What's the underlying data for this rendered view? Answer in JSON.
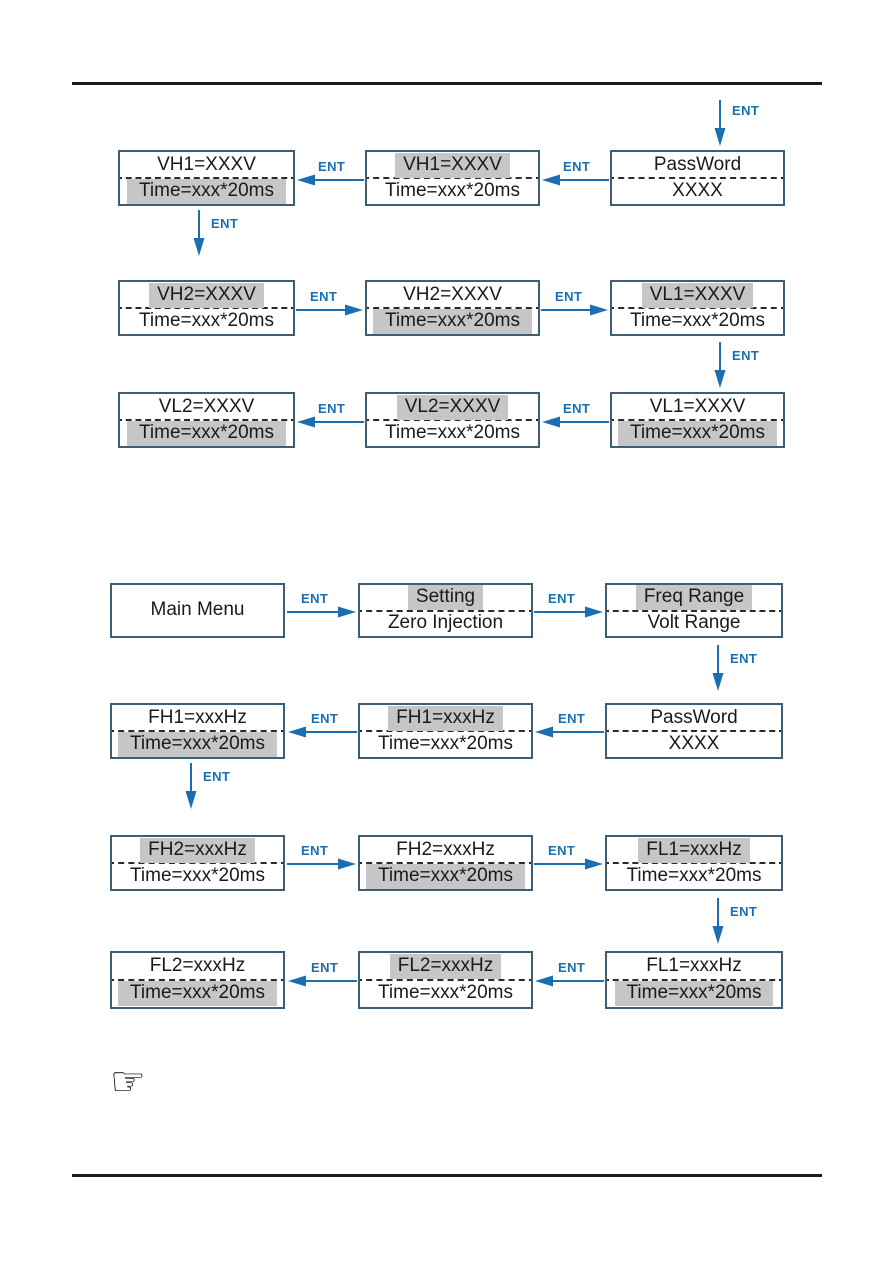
{
  "colors": {
    "lcd_border": "#3d5f76",
    "highlight": "#c6c6c6",
    "arrow_blue": "#1b6fb0",
    "rule_black": "#1c1c1c",
    "text_black": "#1a1a1a"
  },
  "labels": {
    "ent": "ENT"
  },
  "icons": {
    "hand": "☞"
  },
  "volt_section": {
    "screens": [
      {
        "id": "vh1-left",
        "top": "VH1=XXXV",
        "bottom": "Time=xxx*20ms",
        "selected": "bottom"
      },
      {
        "id": "vh1-mid",
        "top": "VH1=XXXV",
        "bottom": "Time=xxx*20ms",
        "selected": "top"
      },
      {
        "id": "password",
        "top": "PassWord",
        "bottom": "XXXX",
        "selected": "none"
      },
      {
        "id": "vh2-left",
        "top": "VH2=XXXV",
        "bottom": "Time=xxx*20ms",
        "selected": "top"
      },
      {
        "id": "vh2-mid",
        "top": "VH2=XXXV",
        "bottom": "Time=xxx*20ms",
        "selected": "bottom"
      },
      {
        "id": "vl1-right",
        "top": "VL1=XXXV",
        "bottom": "Time=xxx*20ms",
        "selected": "top"
      },
      {
        "id": "vl2-left",
        "top": "VL2=XXXV",
        "bottom": "Time=xxx*20ms",
        "selected": "bottom"
      },
      {
        "id": "vl2-mid",
        "top": "VL2=XXXV",
        "bottom": "Time=xxx*20ms",
        "selected": "top"
      },
      {
        "id": "vl1-bottom",
        "top": "VL1=XXXV",
        "bottom": "Time=xxx*20ms",
        "selected": "bottom"
      }
    ]
  },
  "freq_section": {
    "screens": [
      {
        "id": "main-menu",
        "top": "Main Menu",
        "bottom": "",
        "selected": "none"
      },
      {
        "id": "setting",
        "top": "Setting",
        "bottom": "Zero Injection",
        "selected": "top"
      },
      {
        "id": "freq-range",
        "top": "Freq Range",
        "bottom": "Volt Range",
        "selected": "top"
      },
      {
        "id": "fh1-left",
        "top": "FH1=xxxHz",
        "bottom": "Time=xxx*20ms",
        "selected": "bottom"
      },
      {
        "id": "fh1-mid",
        "top": "FH1=xxxHz",
        "bottom": "Time=xxx*20ms",
        "selected": "top"
      },
      {
        "id": "password2",
        "top": "PassWord",
        "bottom": "XXXX",
        "selected": "none"
      },
      {
        "id": "fh2-left",
        "top": "FH2=xxxHz",
        "bottom": "Time=xxx*20ms",
        "selected": "top"
      },
      {
        "id": "fh2-mid",
        "top": "FH2=xxxHz",
        "bottom": "Time=xxx*20ms",
        "selected": "bottom"
      },
      {
        "id": "fl1-right",
        "top": "FL1=xxxHz",
        "bottom": "Time=xxx*20ms",
        "selected": "top"
      },
      {
        "id": "fl2-left",
        "top": "FL2=xxxHz",
        "bottom": "Time=xxx*20ms",
        "selected": "bottom"
      },
      {
        "id": "fl2-mid",
        "top": "FL2=xxxHz",
        "bottom": "Time=xxx*20ms",
        "selected": "top"
      },
      {
        "id": "fl1-bottom",
        "top": "FL1=xxxHz",
        "bottom": "Time=xxx*20ms",
        "selected": "bottom"
      }
    ]
  },
  "transitions": [
    {
      "id": "t01",
      "label": "ENT",
      "dir": "down"
    },
    {
      "id": "t02",
      "label": "ENT",
      "dir": "left"
    },
    {
      "id": "t03",
      "label": "ENT",
      "dir": "left"
    },
    {
      "id": "t04",
      "label": "ENT",
      "dir": "down"
    },
    {
      "id": "t05",
      "label": "ENT",
      "dir": "right"
    },
    {
      "id": "t06",
      "label": "ENT",
      "dir": "right"
    },
    {
      "id": "t07",
      "label": "ENT",
      "dir": "down"
    },
    {
      "id": "t08",
      "label": "ENT",
      "dir": "left"
    },
    {
      "id": "t09",
      "label": "ENT",
      "dir": "left"
    },
    {
      "id": "t10",
      "label": "ENT",
      "dir": "right"
    },
    {
      "id": "t11",
      "label": "ENT",
      "dir": "right"
    },
    {
      "id": "t12",
      "label": "ENT",
      "dir": "down"
    },
    {
      "id": "t13",
      "label": "ENT",
      "dir": "left"
    },
    {
      "id": "t14",
      "label": "ENT",
      "dir": "left"
    },
    {
      "id": "t15",
      "label": "ENT",
      "dir": "down"
    },
    {
      "id": "t16",
      "label": "ENT",
      "dir": "right"
    },
    {
      "id": "t17",
      "label": "ENT",
      "dir": "right"
    },
    {
      "id": "t18",
      "label": "ENT",
      "dir": "down"
    },
    {
      "id": "t19",
      "label": "ENT",
      "dir": "left"
    },
    {
      "id": "t20",
      "label": "ENT",
      "dir": "left"
    }
  ]
}
